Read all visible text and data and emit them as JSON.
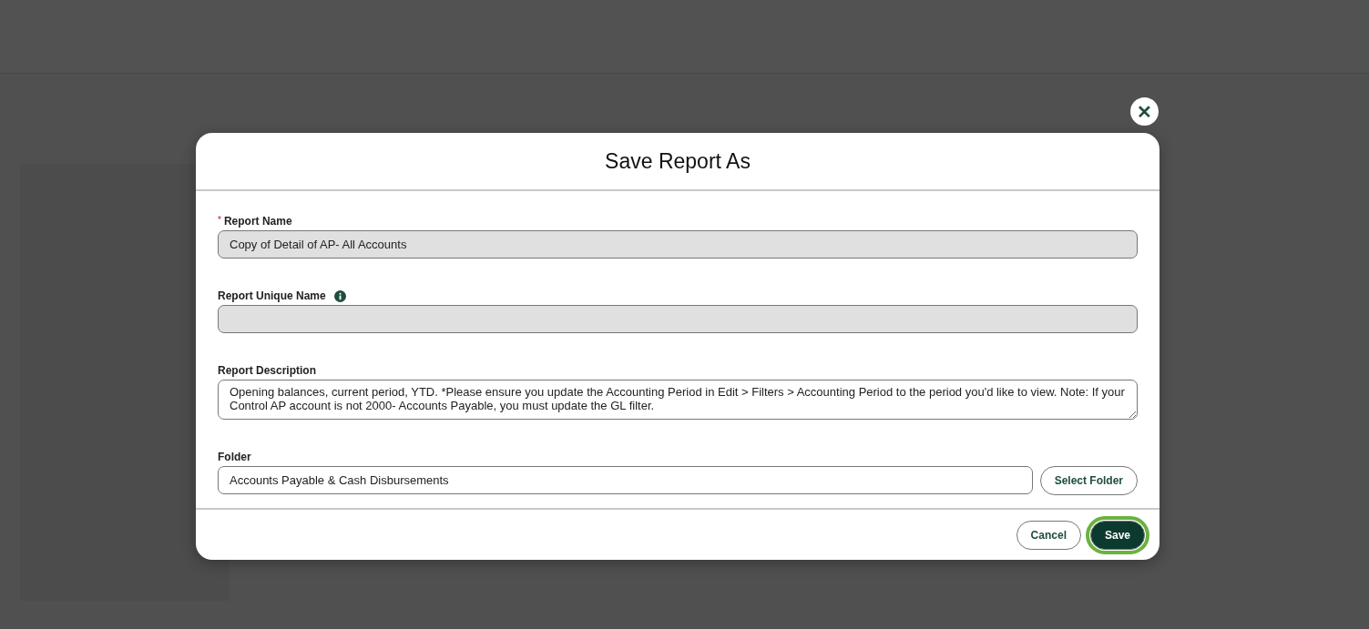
{
  "dialog": {
    "title": "Save Report As",
    "close_label": "✕",
    "fields": [
      {
        "kind": "input",
        "label": "Report Name",
        "required": true,
        "required_mark": "*",
        "info": false,
        "readonly": true,
        "value": "Copy of Detail of AP- All Accounts"
      },
      {
        "kind": "input",
        "label": "Report Unique Name",
        "required": false,
        "info": true,
        "readonly": true
      },
      {
        "kind": "textarea",
        "label": "Report Description",
        "required": false,
        "info": false,
        "readonly": false,
        "value": "Opening balances, current period, YTD. *Please ensure you update the Accounting Period in Edit > Filters > Accounting Period to the period you'd like to view. Note: If your Control AP account is not 2000- Accounts Payable, you must update the GL filter."
      },
      {
        "kind": "folder",
        "label": "Folder",
        "required": false,
        "info": false,
        "readonly": false,
        "value": "Accounts Payable & Cash Disbursements",
        "button": "Select Folder"
      }
    ],
    "buttons": [
      {
        "label": "Cancel",
        "primary": false,
        "highlighted": false
      },
      {
        "label": "Save",
        "primary": true,
        "highlighted": true
      }
    ]
  }
}
